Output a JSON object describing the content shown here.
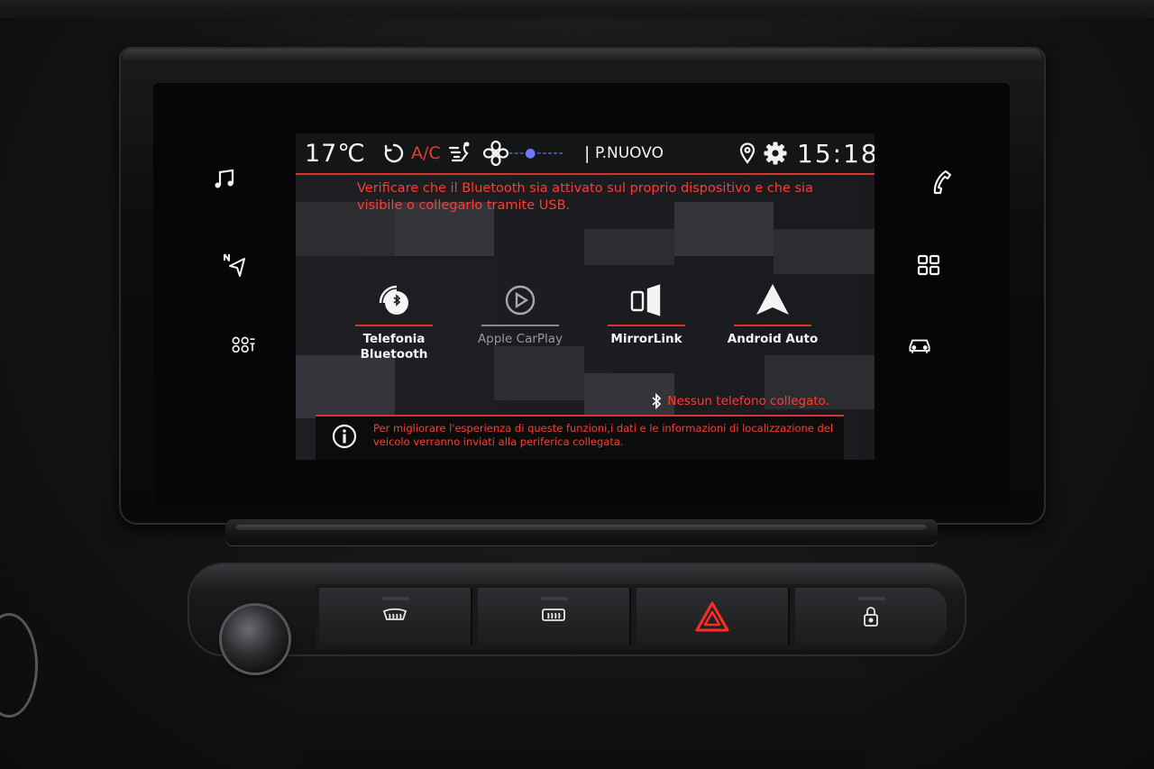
{
  "status_bar": {
    "temperature": "17℃",
    "ac_label": "A/C",
    "fan_level_display": "---●-----",
    "separator": "|",
    "source": "P.NUOVO",
    "clock": "15:18"
  },
  "warning_message": "Verificare che il Bluetooth sia attivato sul proprio dispositivo e che sia visibile o collegarlo tramite USB.",
  "apps": [
    {
      "id": "telefonia-bluetooth",
      "label_line1": "Telefonia",
      "label_line2": "Bluetooth",
      "enabled": true,
      "icon": "bluetooth-phone-icon"
    },
    {
      "id": "apple-carplay",
      "label_line1": "Apple CarPlay",
      "label_line2": "",
      "enabled": false,
      "icon": "play-circle-icon"
    },
    {
      "id": "mirrorlink",
      "label_line1": "MirrorLink",
      "label_line2": "",
      "enabled": true,
      "icon": "mirror-phone-icon"
    },
    {
      "id": "android-auto",
      "label_line1": "Android Auto",
      "label_line2": "",
      "enabled": true,
      "icon": "android-auto-icon"
    }
  ],
  "bluetooth_status": "Nessun telefono collegato.",
  "info_message": "Per migliorare l'esperienza di queste funzioni,i dati e le informazioni di localizzazione del veicolo verranno inviati alla periferica collegata.",
  "side_menu_left": [
    "music-note-icon",
    "navigation-icon",
    "driving-aids-icon"
  ],
  "side_menu_right": [
    "phone-icon",
    "apps-grid-icon",
    "car-icon"
  ],
  "hardware_buttons": [
    "windshield-defrost-icon",
    "rear-defrost-icon",
    "hazard-icon",
    "lock-icon"
  ],
  "colors": {
    "accent": "#d8342a",
    "warning_text": "#ff3b33",
    "text": "#f2f2f2"
  }
}
